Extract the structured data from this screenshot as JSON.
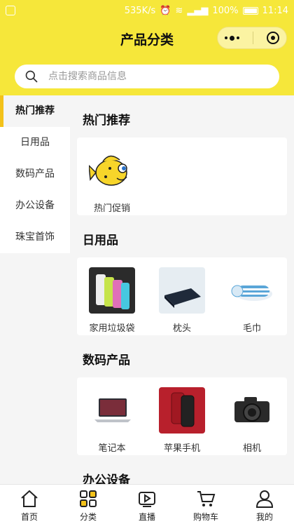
{
  "status_bar": {
    "speed": "535K/s",
    "battery": "100%",
    "time": "11:14"
  },
  "header": {
    "title": "产品分类"
  },
  "search": {
    "placeholder": "点击搜索商品信息"
  },
  "sidebar": {
    "items": [
      {
        "label": "热门推荐",
        "active": true
      },
      {
        "label": "日用品"
      },
      {
        "label": "数码产品"
      },
      {
        "label": "办公设备"
      },
      {
        "label": "珠宝首饰"
      }
    ]
  },
  "sections": [
    {
      "title": "热门推荐",
      "items": [
        {
          "label": "热门促销",
          "icon": "fish-mascot-icon"
        }
      ]
    },
    {
      "title": "日用品",
      "items": [
        {
          "label": "家用垃圾袋",
          "icon": "garbage-bags-image"
        },
        {
          "label": "枕头",
          "icon": "pillow-image"
        },
        {
          "label": "毛巾",
          "icon": "towel-image"
        }
      ]
    },
    {
      "title": "数码产品",
      "items": [
        {
          "label": "笔记本",
          "icon": "laptop-image"
        },
        {
          "label": "苹果手机",
          "icon": "iphone-image"
        },
        {
          "label": "相机",
          "icon": "camera-image"
        }
      ]
    },
    {
      "title": "办公设备",
      "items": []
    }
  ],
  "tabbar": {
    "items": [
      {
        "label": "首页",
        "icon": "home-icon"
      },
      {
        "label": "分类",
        "icon": "category-grid-icon",
        "active": true
      },
      {
        "label": "直播",
        "icon": "live-play-icon"
      },
      {
        "label": "购物车",
        "icon": "cart-icon"
      },
      {
        "label": "我的",
        "icon": "profile-icon"
      }
    ]
  },
  "colors": {
    "brand_yellow": "#f6e73a",
    "active_indicator": "#f3c21a"
  }
}
